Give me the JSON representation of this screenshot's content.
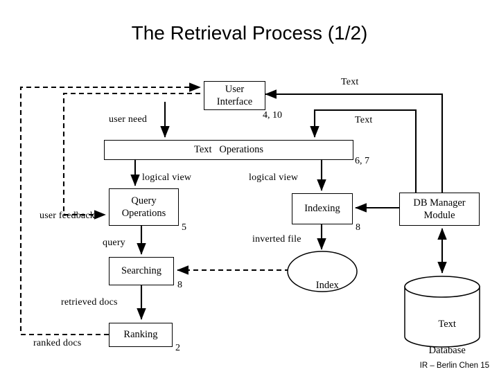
{
  "slide": {
    "title": "The Retrieval Process (1/2)",
    "footer": "IR – Berlin Chen 15"
  },
  "nodes": {
    "user_interface": {
      "line1": "User",
      "line2": "Interface"
    },
    "text_operations": {
      "line1": "Text   Operations"
    },
    "query_operations": {
      "line1": "Query",
      "line2": "Operations"
    },
    "indexing": {
      "line1": "Indexing"
    },
    "db_manager": {
      "line1": "DB Manager",
      "line2": "Module"
    },
    "searching": {
      "line1": "Searching"
    },
    "ranking": {
      "line1": "Ranking"
    },
    "index_store": {
      "line1": "Index"
    },
    "text_database": {
      "line1": "Text",
      "line2": "Database"
    }
  },
  "edge_labels": {
    "text_top": "Text",
    "text_mid": "Text",
    "user_need": "user need",
    "logical_view_left": "logical view",
    "logical_view_right": "logical view",
    "user_feedback": "user feedback",
    "query": "query",
    "inverted_file": "inverted file",
    "retrieved_docs": "retrieved docs",
    "ranked_docs": "ranked docs"
  },
  "step_numbers": {
    "ui": "4, 10",
    "text_ops": "6, 7",
    "query_ops": "5",
    "indexing": "8",
    "searching": "8",
    "ranking": "2"
  },
  "colors": {
    "stroke": "#000000",
    "background": "#ffffff",
    "text": "#000000"
  }
}
